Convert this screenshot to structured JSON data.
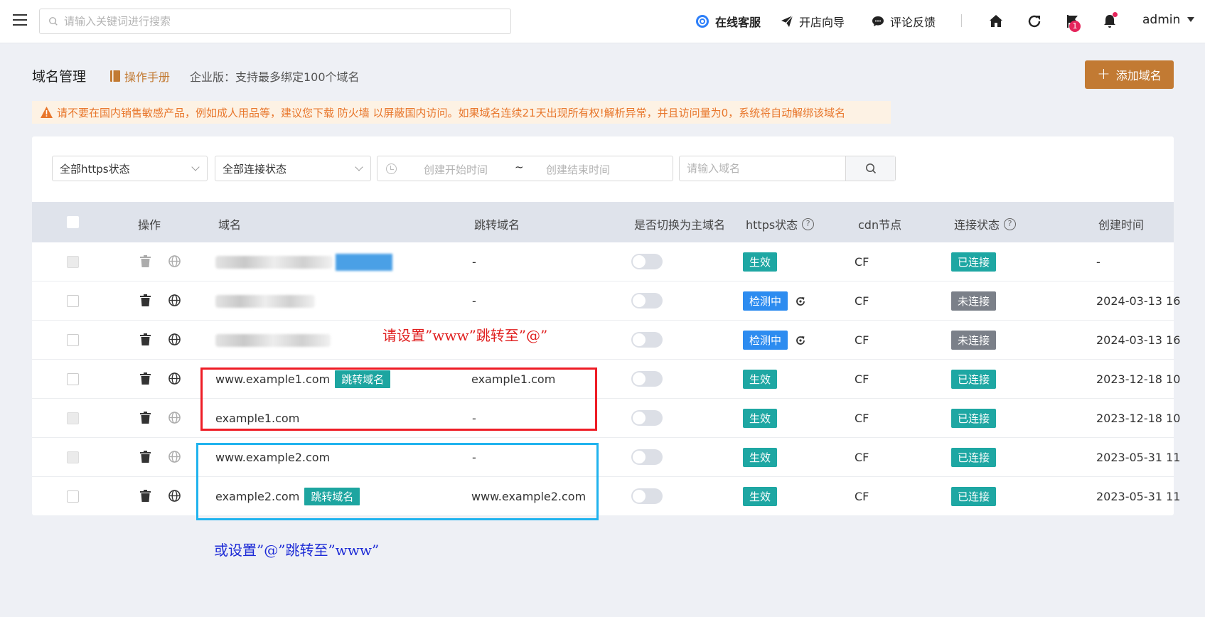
{
  "topbar": {
    "search_placeholder": "请输入关键词进行搜索",
    "online_service": "在线客服",
    "setup_guide": "开店向导",
    "feedback": "评论反馈",
    "flag_count": "1",
    "user": "admin"
  },
  "header": {
    "title": "域名管理",
    "manual": "操作手册",
    "edition": "企业版：支持最多绑定100个域名",
    "add_button": "添加域名",
    "warning": "请不要在国内销售敏感产品，例如成人用品等，建议您下载 防火墙 以屏蔽国内访问。如果域名连续21天出现所有权!解析异常，并且访问量为0，系统将自动解绑该域名"
  },
  "filters": {
    "https_status": "全部https状态",
    "connect_status": "全部连接状态",
    "date_start_placeholder": "创建开始时间",
    "date_sep": "~",
    "date_end_placeholder": "创建结束时间",
    "domain_placeholder": "请输入域名"
  },
  "table": {
    "columns": {
      "action": "操作",
      "domain": "域名",
      "redirect_domain": "跳转域名",
      "switch_primary": "是否切换为主域名",
      "https_status": "https状态",
      "cdn_node": "cdn节点",
      "connect_status": "连接状态",
      "created_at": "创建时间"
    },
    "redirect_tag": "跳转域名",
    "rows": [
      {
        "domain": "",
        "redirect": "-",
        "https": "生效",
        "cdn": "CF",
        "connect": "已连接",
        "created": "-"
      },
      {
        "domain": "",
        "redirect": "-",
        "https": "检测中",
        "cdn": "CF",
        "connect": "未连接",
        "created": "2024-03-13 16"
      },
      {
        "domain": "",
        "redirect": "",
        "https": "检测中",
        "cdn": "CF",
        "connect": "未连接",
        "created": "2024-03-13 16"
      },
      {
        "domain": "www.example1.com",
        "redirect": "example1.com",
        "https": "生效",
        "cdn": "CF",
        "connect": "已连接",
        "created": "2023-12-18 10"
      },
      {
        "domain": "example1.com",
        "redirect": "-",
        "https": "生效",
        "cdn": "CF",
        "connect": "已连接",
        "created": "2023-12-18 10"
      },
      {
        "domain": "www.example2.com",
        "redirect": "-",
        "https": "生效",
        "cdn": "CF",
        "connect": "已连接",
        "created": "2023-05-31 11"
      },
      {
        "domain": "example2.com",
        "redirect": "www.example2.com",
        "https": "生效",
        "cdn": "CF",
        "connect": "已连接",
        "created": "2023-05-31 11"
      }
    ]
  },
  "annotations": {
    "red_note": "请设置”www”跳转至”@”",
    "blue_note": "或设置”@”跳转至”www”"
  },
  "colors": {
    "accent": "#c27a33",
    "teal": "#1ea7a3",
    "blue": "#2d8cf0",
    "gray": "#7b8089",
    "red_box": "#ee1c25",
    "blue_box": "#20b3ee"
  }
}
